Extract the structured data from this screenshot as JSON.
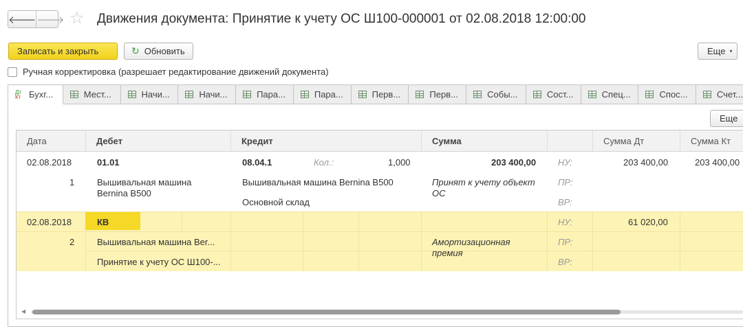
{
  "nav": {
    "back_icon": "arrow-left-icon",
    "forward_icon": "arrow-right-icon",
    "back": "🡐",
    "forward": "🡒",
    "star": "☆"
  },
  "window": {
    "title": "Движения документа: Принятие к учету ОС Ш100-000001 от 02.08.2018 12:00:00"
  },
  "toolbar": {
    "save_close_label": "Записать и закрыть",
    "refresh_label": "Обновить",
    "refresh_icon": "↻",
    "more_label": "Еще",
    "more_caret": "▾"
  },
  "manual_edit": {
    "checked": false,
    "label": "Ручная корректировка (разрешает редактирование движений документа)"
  },
  "tabs": [
    {
      "label": "Бухг...",
      "icon": "dt-kt-icon",
      "active": true
    },
    {
      "label": "Мест...",
      "icon": "table-icon"
    },
    {
      "label": "Начи...",
      "icon": "table-icon"
    },
    {
      "label": "Начи...",
      "icon": "table-icon"
    },
    {
      "label": "Пара...",
      "icon": "table-icon"
    },
    {
      "label": "Пара...",
      "icon": "table-icon"
    },
    {
      "label": "Перв...",
      "icon": "table-icon"
    },
    {
      "label": "Перв...",
      "icon": "table-icon"
    },
    {
      "label": "Собы...",
      "icon": "table-icon"
    },
    {
      "label": "Сост...",
      "icon": "table-icon"
    },
    {
      "label": "Спец...",
      "icon": "table-icon"
    },
    {
      "label": "Спос...",
      "icon": "table-icon"
    },
    {
      "label": "Счет...",
      "icon": "table-icon"
    }
  ],
  "tab_icon_dt": "Дт",
  "tab_icon_kt": "Кт",
  "panel": {
    "more_label": "Еще"
  },
  "grid": {
    "headers": {
      "date": "Дата",
      "debit": "Дебет",
      "credit": "Кредит",
      "sum": "Сумма",
      "sum_dt": "Сумма Дт",
      "sum_kt": "Сумма Кт"
    },
    "rows": [
      {
        "date": "02.08.2018",
        "number": "1",
        "debit_account": "01.01",
        "debit_sub1": "Вышивальная машина",
        "debit_sub1b": "Bernina B500",
        "credit_account": "08.04.1",
        "qty_label": "Кол.:",
        "qty": "1,000",
        "credit_sub1": "Вышивальная машина Bernina B500",
        "credit_sub2": "Основной склад",
        "sum": "203 400,00",
        "content1": "Принят к учету объект",
        "content2": "ОС",
        "nu": "НУ:",
        "pr": "ПР:",
        "vr": "ВР:",
        "sum_dt": "203 400,00",
        "sum_kt": "203 400,00"
      },
      {
        "date": "02.08.2018",
        "number": "2",
        "debit_account": "КВ",
        "debit_sub1": "Вышивальная машина Ber...",
        "debit_sub2": "Принятие к учету ОС Ш100-...",
        "content1": "Амортизационная",
        "content2": "премия",
        "nu": "НУ:",
        "pr": "ПР:",
        "vr": "ВР:",
        "sum_dt": "61 020,00"
      }
    ]
  },
  "colors": {
    "primary_button": "#f2d21c",
    "highlight_row": "#fcf3b5",
    "highlight_cell": "#f6d926"
  }
}
